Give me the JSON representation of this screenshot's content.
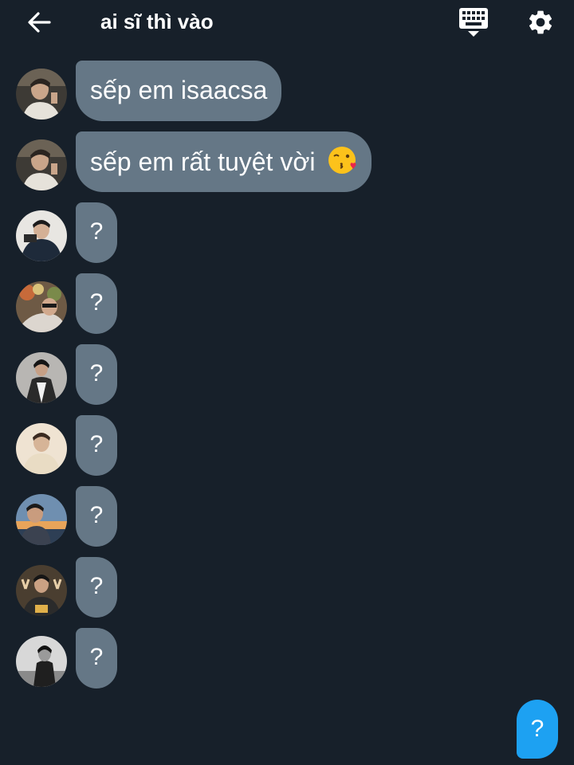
{
  "header": {
    "back_icon": "arrow-left-icon",
    "title": "ai sĩ thì vào",
    "keyboard_icon": "keyboard-icon",
    "settings_icon": "gear-icon"
  },
  "messages": [
    {
      "text": "sếp em isaacsa",
      "emoji": ""
    },
    {
      "text": "sếp em rất tuyệt vời",
      "emoji": "kissing-face-icon"
    },
    {
      "text": "?"
    },
    {
      "text": "?"
    },
    {
      "text": "?"
    },
    {
      "text": "?"
    },
    {
      "text": "?"
    },
    {
      "text": "?"
    },
    {
      "text": "?"
    }
  ],
  "fab": {
    "label": "?"
  },
  "colors": {
    "background": "#17202a",
    "bubble": "#657786",
    "accent": "#1da1f2",
    "text": "#ffffff"
  }
}
